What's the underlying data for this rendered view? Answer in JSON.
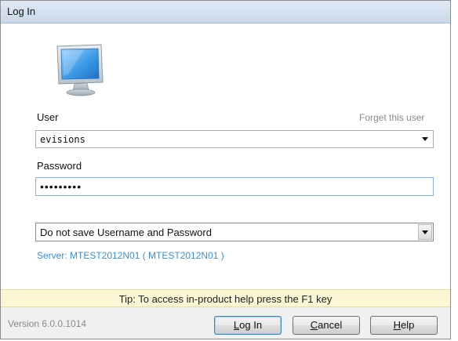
{
  "window": {
    "title": "Log In"
  },
  "user": {
    "label": "User",
    "forget_link": "Forget this user",
    "value": "evisions"
  },
  "password": {
    "label": "Password",
    "value": "abcdefghi"
  },
  "save_option": {
    "selected": "Do not save Username and Password"
  },
  "server": {
    "text": "Server: MTEST2012N01 ( MTEST2012N01 )"
  },
  "tip": {
    "text": "Tip: To access in-product help press the F1 key"
  },
  "footer": {
    "version": "Version 6.0.0.1014",
    "login_button": {
      "prefix": "",
      "hotkey": "L",
      "suffix": "og In"
    },
    "cancel_button": {
      "prefix": "",
      "hotkey": "C",
      "suffix": "ancel"
    },
    "help_button": {
      "prefix": "",
      "hotkey": "H",
      "suffix": "elp"
    }
  },
  "colors": {
    "link_blue": "#3d8fd1",
    "tip_bg": "#fbf6d3",
    "focus_border": "#7eb4ea"
  },
  "icons": {
    "app_icon": "monitor-icon"
  }
}
